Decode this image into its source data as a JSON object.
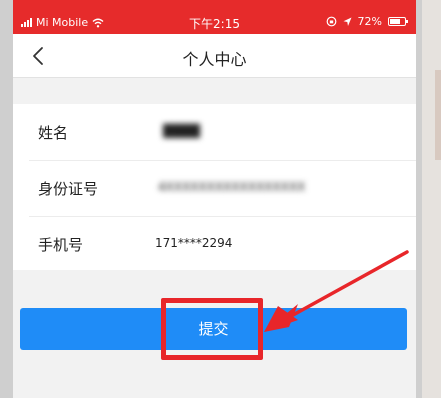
{
  "status_bar": {
    "carrier": "Mi Mobile",
    "time": "下午2:15",
    "battery": "72%",
    "battery_level": 0.72
  },
  "header": {
    "title": "个人中心"
  },
  "form": {
    "rows": [
      {
        "label": "姓名",
        "value": "████"
      },
      {
        "label": "身份证号",
        "value": "4XXXXXXXXXXXXXXXXX"
      },
      {
        "label": "手机号",
        "value": "171****2294"
      }
    ]
  },
  "submit_label": "提交",
  "colors": {
    "status_bar": "#e62b2b",
    "primary_button": "#1f8cf7",
    "annotation": "#e8262a"
  },
  "icons": [
    "signal-icon",
    "wifi-icon",
    "back-icon",
    "lock-rotation-icon",
    "location-icon",
    "battery-icon",
    "annotation-arrow-icon"
  ]
}
